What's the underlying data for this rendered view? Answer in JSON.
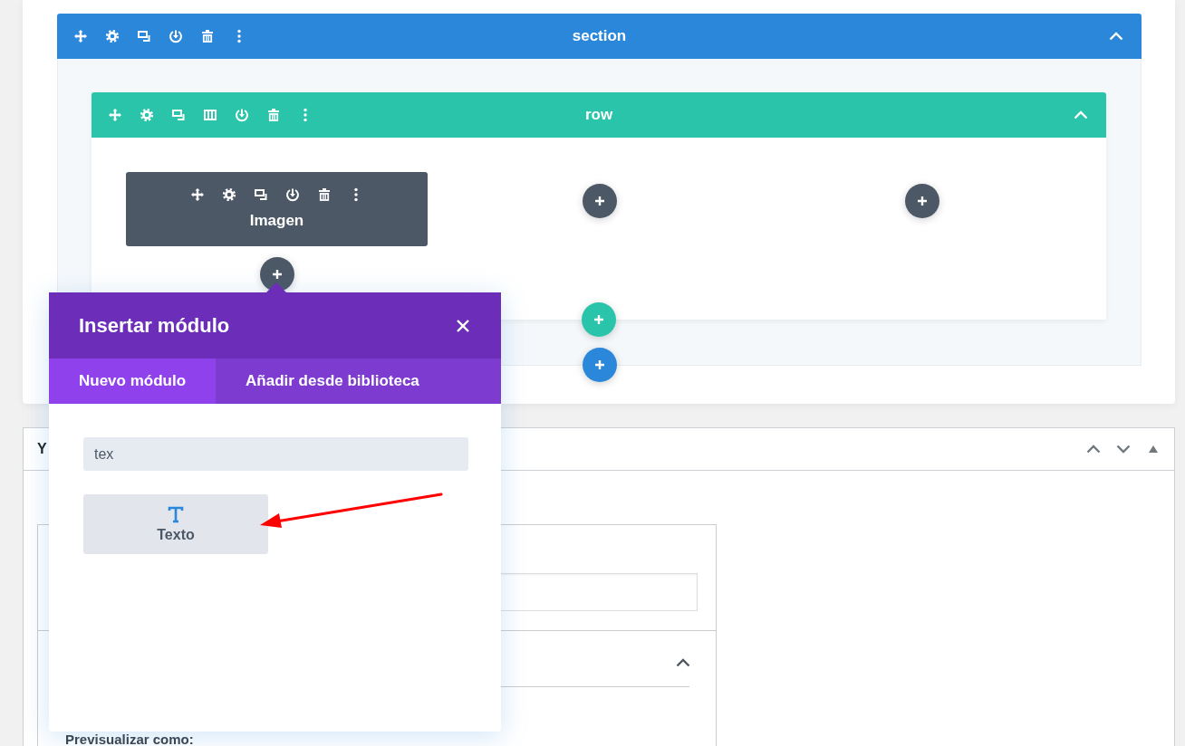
{
  "section": {
    "title": "section"
  },
  "row": {
    "title": "row"
  },
  "module": {
    "label": "Imagen"
  },
  "popup": {
    "title": "Insertar módulo",
    "tabs": [
      {
        "label": "Nuevo módulo",
        "selected": true
      },
      {
        "label": "Añadir desde biblioteca",
        "selected": false
      }
    ],
    "search": {
      "value": "tex"
    },
    "results": [
      {
        "label": "Texto"
      }
    ]
  },
  "metabox": {
    "title": "Y",
    "preview_label": "Previsualizar como:"
  }
}
